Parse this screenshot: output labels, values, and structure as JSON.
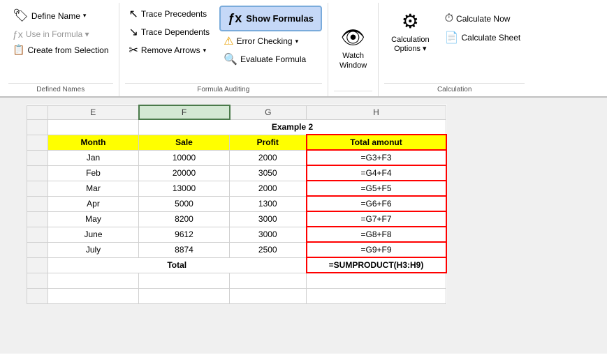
{
  "ribbon": {
    "groups": [
      {
        "label": "Defined Names",
        "items": [
          {
            "id": "define-name",
            "label": "Define Name",
            "icon": "🏷",
            "type": "large",
            "hasDropdown": true
          },
          {
            "id": "use-in-formula",
            "label": "Use in Formula ▾",
            "icon": "fx",
            "type": "small",
            "disabled": true
          },
          {
            "id": "create-from-selection",
            "label": "Create from Selection",
            "icon": "📋",
            "type": "small"
          }
        ]
      },
      {
        "label": "Formula Auditing",
        "items": [
          {
            "id": "trace-precedents",
            "label": "Trace Precedents",
            "icon": "⬅",
            "type": "small"
          },
          {
            "id": "trace-dependents",
            "label": "Trace Dependents",
            "icon": "⬇",
            "type": "small"
          },
          {
            "id": "remove-arrows",
            "label": "Remove Arrows",
            "icon": "↩",
            "type": "small",
            "hasDropdown": true
          },
          {
            "id": "show-formulas",
            "label": "Show Formulas",
            "icon": "fx",
            "type": "medium",
            "active": true
          },
          {
            "id": "error-checking",
            "label": "Error Checking",
            "icon": "⚠",
            "type": "small",
            "hasDropdown": true
          },
          {
            "id": "evaluate-formula",
            "label": "Evaluate Formula",
            "icon": "🔍",
            "type": "small"
          }
        ]
      },
      {
        "label": "",
        "items": [
          {
            "id": "watch-window",
            "label": "Watch\nWindow",
            "icon": "👁",
            "type": "large"
          }
        ]
      },
      {
        "label": "Calculation",
        "items": [
          {
            "id": "calculation-options",
            "label": "Calculation\nOptions ▾",
            "icon": "⚙",
            "type": "large"
          },
          {
            "id": "calculate-now",
            "label": "Calculate Now",
            "icon": "⏱",
            "type": "small"
          },
          {
            "id": "calculate-sheet",
            "label": "Calculate Sheet",
            "icon": "📄",
            "type": "small"
          }
        ]
      }
    ]
  },
  "spreadsheet": {
    "columns": [
      "E",
      "F",
      "G",
      "H"
    ],
    "rows": [
      {
        "rowNum": "",
        "e": "",
        "f": "Example 2",
        "g": "",
        "h": "",
        "special": "example2"
      },
      {
        "rowNum": "",
        "e": "Month",
        "f": "Sale",
        "g": "Profit",
        "h": "Total amonut",
        "special": "header"
      },
      {
        "rowNum": "",
        "e": "Jan",
        "f": "10000",
        "g": "2000",
        "h": "=G3+F3"
      },
      {
        "rowNum": "",
        "e": "Feb",
        "f": "20000",
        "g": "3050",
        "h": "=G4+F4"
      },
      {
        "rowNum": "",
        "e": "Mar",
        "f": "13000",
        "g": "2000",
        "h": "=G5+F5"
      },
      {
        "rowNum": "",
        "e": "Apr",
        "f": "5000",
        "g": "1300",
        "h": "=G6+F6"
      },
      {
        "rowNum": "",
        "e": "May",
        "f": "8200",
        "g": "3000",
        "h": "=G7+F7"
      },
      {
        "rowNum": "",
        "e": "June",
        "f": "9612",
        "g": "3000",
        "h": "=G8+F8"
      },
      {
        "rowNum": "",
        "e": "July",
        "f": "8874",
        "g": "2500",
        "h": "=G9+F9"
      },
      {
        "rowNum": "",
        "e": "Total",
        "f": "",
        "g": "",
        "h": "=SUMPRODUCT(H3:H9)",
        "special": "total"
      }
    ]
  }
}
